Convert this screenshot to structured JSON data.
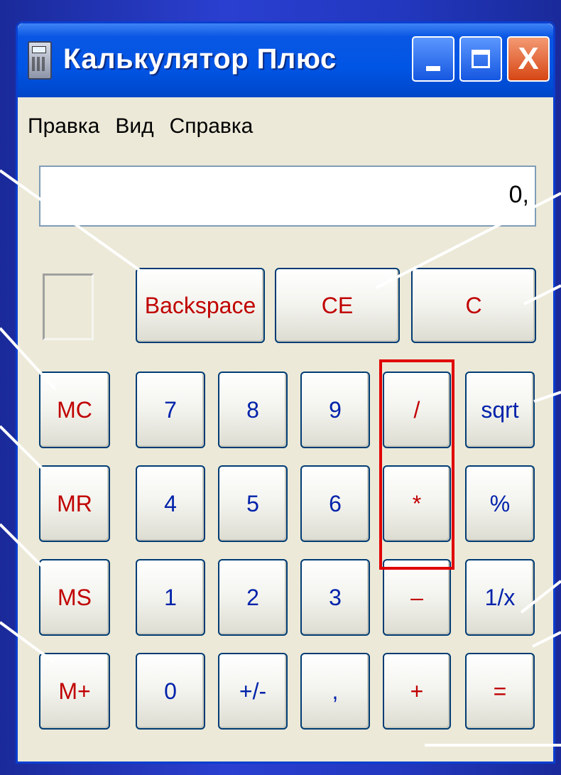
{
  "window": {
    "title": "Калькулятор Плюс",
    "icon": "calculator-icon",
    "controls": {
      "minimize": "minimize-icon",
      "maximize": "maximize-icon",
      "close": "X"
    }
  },
  "menu": {
    "items": [
      "Правка",
      "Вид",
      "Справка"
    ]
  },
  "display": {
    "value": "0,"
  },
  "top_buttons": [
    "Backspace",
    "CE",
    "C"
  ],
  "memory_buttons": [
    "MC",
    "MR",
    "MS",
    "M+"
  ],
  "rows": [
    [
      "7",
      "8",
      "9",
      "/",
      "sqrt"
    ],
    [
      "4",
      "5",
      "6",
      "*",
      "%"
    ],
    [
      "1",
      "2",
      "3",
      "–",
      "1/x"
    ],
    [
      "0",
      "+/-",
      ",",
      "+",
      "="
    ]
  ],
  "colors": {
    "background": "#2238c0",
    "titlebar": "#0055e5",
    "window": "#ece9d8",
    "digit_text": "#0022aa",
    "operator_text": "#c00000",
    "highlight": "#e00000"
  }
}
